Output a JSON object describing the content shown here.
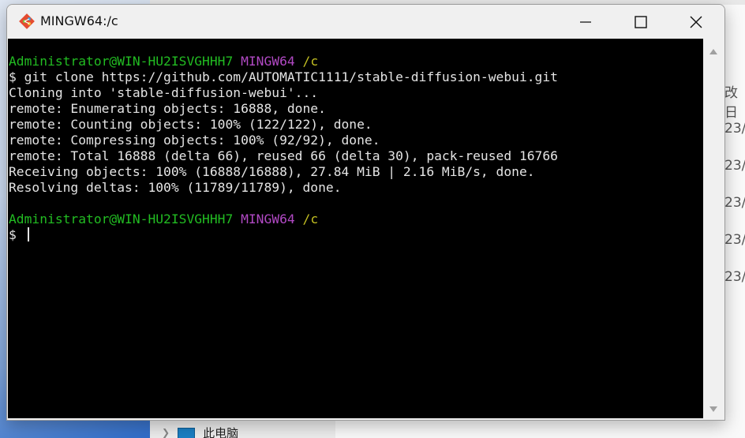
{
  "window": {
    "title": "MINGW64:/c",
    "controls": {
      "minimize_icon": "minimize-icon",
      "maximize_icon": "maximize-icon",
      "close_icon": "close-icon"
    }
  },
  "terminal": {
    "prompt1": {
      "user": "Administrator@WIN-HU2ISVGHHH7",
      "env": "MINGW64",
      "path": "/c"
    },
    "command": "$ git clone https://github.com/AUTOMATIC1111/stable-diffusion-webui.git",
    "output": [
      "Cloning into 'stable-diffusion-webui'...",
      "remote: Enumerating objects: 16888, done.",
      "remote: Counting objects: 100% (122/122), done.",
      "remote: Compressing objects: 100% (92/92), done.",
      "remote: Total 16888 (delta 66), reused 66 (delta 30), pack-reused 16766",
      "Receiving objects: 100% (16888/16888), 27.84 MiB | 2.16 MiB/s, done.",
      "Resolving deltas: 100% (11789/11789), done."
    ],
    "prompt2": {
      "user": "Administrator@WIN-HU2ISVGHHH7",
      "env": "MINGW64",
      "path": "/c"
    },
    "input_prompt": "$ "
  },
  "background": {
    "column_header": "改日",
    "column_cells": [
      "23/",
      "23/",
      "23/",
      "23/",
      "23/"
    ],
    "nav_item": "此电脑"
  },
  "colors": {
    "prompt_user": "#22bc22",
    "prompt_env": "#b149c4",
    "prompt_path": "#c3bf22",
    "terminal_bg": "#000000"
  }
}
